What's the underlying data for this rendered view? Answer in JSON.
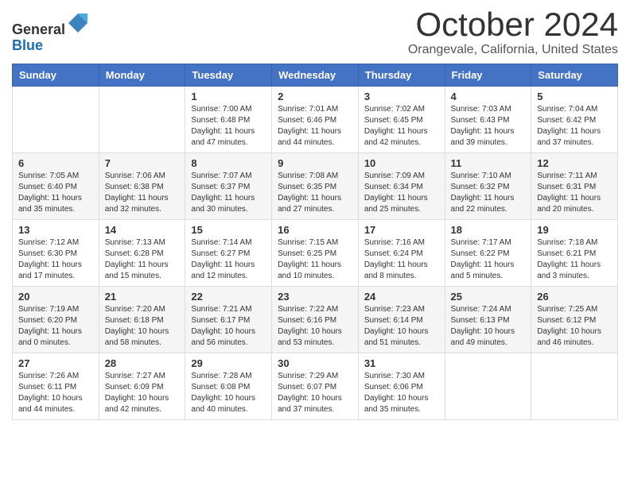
{
  "logo": {
    "general": "General",
    "blue": "Blue"
  },
  "title": "October 2024",
  "location": "Orangevale, California, United States",
  "days_of_week": [
    "Sunday",
    "Monday",
    "Tuesday",
    "Wednesday",
    "Thursday",
    "Friday",
    "Saturday"
  ],
  "weeks": [
    [
      {
        "day": "",
        "sunrise": "",
        "sunset": "",
        "daylight": ""
      },
      {
        "day": "",
        "sunrise": "",
        "sunset": "",
        "daylight": ""
      },
      {
        "day": "1",
        "sunrise": "Sunrise: 7:00 AM",
        "sunset": "Sunset: 6:48 PM",
        "daylight": "Daylight: 11 hours and 47 minutes."
      },
      {
        "day": "2",
        "sunrise": "Sunrise: 7:01 AM",
        "sunset": "Sunset: 6:46 PM",
        "daylight": "Daylight: 11 hours and 44 minutes."
      },
      {
        "day": "3",
        "sunrise": "Sunrise: 7:02 AM",
        "sunset": "Sunset: 6:45 PM",
        "daylight": "Daylight: 11 hours and 42 minutes."
      },
      {
        "day": "4",
        "sunrise": "Sunrise: 7:03 AM",
        "sunset": "Sunset: 6:43 PM",
        "daylight": "Daylight: 11 hours and 39 minutes."
      },
      {
        "day": "5",
        "sunrise": "Sunrise: 7:04 AM",
        "sunset": "Sunset: 6:42 PM",
        "daylight": "Daylight: 11 hours and 37 minutes."
      }
    ],
    [
      {
        "day": "6",
        "sunrise": "Sunrise: 7:05 AM",
        "sunset": "Sunset: 6:40 PM",
        "daylight": "Daylight: 11 hours and 35 minutes."
      },
      {
        "day": "7",
        "sunrise": "Sunrise: 7:06 AM",
        "sunset": "Sunset: 6:38 PM",
        "daylight": "Daylight: 11 hours and 32 minutes."
      },
      {
        "day": "8",
        "sunrise": "Sunrise: 7:07 AM",
        "sunset": "Sunset: 6:37 PM",
        "daylight": "Daylight: 11 hours and 30 minutes."
      },
      {
        "day": "9",
        "sunrise": "Sunrise: 7:08 AM",
        "sunset": "Sunset: 6:35 PM",
        "daylight": "Daylight: 11 hours and 27 minutes."
      },
      {
        "day": "10",
        "sunrise": "Sunrise: 7:09 AM",
        "sunset": "Sunset: 6:34 PM",
        "daylight": "Daylight: 11 hours and 25 minutes."
      },
      {
        "day": "11",
        "sunrise": "Sunrise: 7:10 AM",
        "sunset": "Sunset: 6:32 PM",
        "daylight": "Daylight: 11 hours and 22 minutes."
      },
      {
        "day": "12",
        "sunrise": "Sunrise: 7:11 AM",
        "sunset": "Sunset: 6:31 PM",
        "daylight": "Daylight: 11 hours and 20 minutes."
      }
    ],
    [
      {
        "day": "13",
        "sunrise": "Sunrise: 7:12 AM",
        "sunset": "Sunset: 6:30 PM",
        "daylight": "Daylight: 11 hours and 17 minutes."
      },
      {
        "day": "14",
        "sunrise": "Sunrise: 7:13 AM",
        "sunset": "Sunset: 6:28 PM",
        "daylight": "Daylight: 11 hours and 15 minutes."
      },
      {
        "day": "15",
        "sunrise": "Sunrise: 7:14 AM",
        "sunset": "Sunset: 6:27 PM",
        "daylight": "Daylight: 11 hours and 12 minutes."
      },
      {
        "day": "16",
        "sunrise": "Sunrise: 7:15 AM",
        "sunset": "Sunset: 6:25 PM",
        "daylight": "Daylight: 11 hours and 10 minutes."
      },
      {
        "day": "17",
        "sunrise": "Sunrise: 7:16 AM",
        "sunset": "Sunset: 6:24 PM",
        "daylight": "Daylight: 11 hours and 8 minutes."
      },
      {
        "day": "18",
        "sunrise": "Sunrise: 7:17 AM",
        "sunset": "Sunset: 6:22 PM",
        "daylight": "Daylight: 11 hours and 5 minutes."
      },
      {
        "day": "19",
        "sunrise": "Sunrise: 7:18 AM",
        "sunset": "Sunset: 6:21 PM",
        "daylight": "Daylight: 11 hours and 3 minutes."
      }
    ],
    [
      {
        "day": "20",
        "sunrise": "Sunrise: 7:19 AM",
        "sunset": "Sunset: 6:20 PM",
        "daylight": "Daylight: 11 hours and 0 minutes."
      },
      {
        "day": "21",
        "sunrise": "Sunrise: 7:20 AM",
        "sunset": "Sunset: 6:18 PM",
        "daylight": "Daylight: 10 hours and 58 minutes."
      },
      {
        "day": "22",
        "sunrise": "Sunrise: 7:21 AM",
        "sunset": "Sunset: 6:17 PM",
        "daylight": "Daylight: 10 hours and 56 minutes."
      },
      {
        "day": "23",
        "sunrise": "Sunrise: 7:22 AM",
        "sunset": "Sunset: 6:16 PM",
        "daylight": "Daylight: 10 hours and 53 minutes."
      },
      {
        "day": "24",
        "sunrise": "Sunrise: 7:23 AM",
        "sunset": "Sunset: 6:14 PM",
        "daylight": "Daylight: 10 hours and 51 minutes."
      },
      {
        "day": "25",
        "sunrise": "Sunrise: 7:24 AM",
        "sunset": "Sunset: 6:13 PM",
        "daylight": "Daylight: 10 hours and 49 minutes."
      },
      {
        "day": "26",
        "sunrise": "Sunrise: 7:25 AM",
        "sunset": "Sunset: 6:12 PM",
        "daylight": "Daylight: 10 hours and 46 minutes."
      }
    ],
    [
      {
        "day": "27",
        "sunrise": "Sunrise: 7:26 AM",
        "sunset": "Sunset: 6:11 PM",
        "daylight": "Daylight: 10 hours and 44 minutes."
      },
      {
        "day": "28",
        "sunrise": "Sunrise: 7:27 AM",
        "sunset": "Sunset: 6:09 PM",
        "daylight": "Daylight: 10 hours and 42 minutes."
      },
      {
        "day": "29",
        "sunrise": "Sunrise: 7:28 AM",
        "sunset": "Sunset: 6:08 PM",
        "daylight": "Daylight: 10 hours and 40 minutes."
      },
      {
        "day": "30",
        "sunrise": "Sunrise: 7:29 AM",
        "sunset": "Sunset: 6:07 PM",
        "daylight": "Daylight: 10 hours and 37 minutes."
      },
      {
        "day": "31",
        "sunrise": "Sunrise: 7:30 AM",
        "sunset": "Sunset: 6:06 PM",
        "daylight": "Daylight: 10 hours and 35 minutes."
      },
      {
        "day": "",
        "sunrise": "",
        "sunset": "",
        "daylight": ""
      },
      {
        "day": "",
        "sunrise": "",
        "sunset": "",
        "daylight": ""
      }
    ]
  ]
}
